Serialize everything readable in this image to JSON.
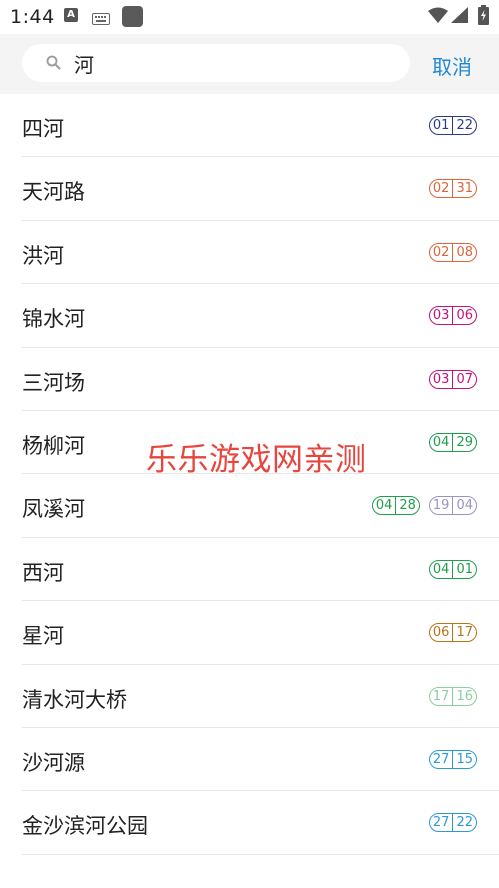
{
  "status_bar": {
    "time": "1:44",
    "indicator_a": "A"
  },
  "search": {
    "query": "河",
    "placeholder": "",
    "cancel_label": "取消"
  },
  "results": [
    {
      "name": "四河",
      "lines": [
        {
          "a": "01",
          "b": "22",
          "color": "#2b3a8c"
        }
      ]
    },
    {
      "name": "天河路",
      "lines": [
        {
          "a": "02",
          "b": "31",
          "color": "#e0643a"
        }
      ]
    },
    {
      "name": "洪河",
      "lines": [
        {
          "a": "02",
          "b": "08",
          "color": "#e0643a"
        }
      ]
    },
    {
      "name": "锦水河",
      "lines": [
        {
          "a": "03",
          "b": "06",
          "color": "#c4127a"
        }
      ]
    },
    {
      "name": "三河场",
      "lines": [
        {
          "a": "03",
          "b": "07",
          "color": "#c4127a"
        }
      ]
    },
    {
      "name": "杨柳河",
      "lines": [
        {
          "a": "04",
          "b": "29",
          "color": "#1f9e4e"
        }
      ]
    },
    {
      "name": "凤溪河",
      "lines": [
        {
          "a": "04",
          "b": "28",
          "color": "#1f9e4e"
        },
        {
          "a": "19",
          "b": "04",
          "color": "#9a93c4"
        }
      ]
    },
    {
      "name": "西河",
      "lines": [
        {
          "a": "04",
          "b": "01",
          "color": "#1f9e4e"
        }
      ]
    },
    {
      "name": "星河",
      "lines": [
        {
          "a": "06",
          "b": "17",
          "color": "#b8741a"
        }
      ]
    },
    {
      "name": "清水河大桥",
      "lines": [
        {
          "a": "17",
          "b": "16",
          "color": "#8ccfa0"
        }
      ]
    },
    {
      "name": "沙河源",
      "lines": [
        {
          "a": "27",
          "b": "15",
          "color": "#2a9ad6"
        }
      ]
    },
    {
      "name": "金沙滨河公园",
      "lines": [
        {
          "a": "27",
          "b": "22",
          "color": "#2a9ad6"
        }
      ]
    }
  ],
  "watermark": "乐乐游戏网亲测"
}
